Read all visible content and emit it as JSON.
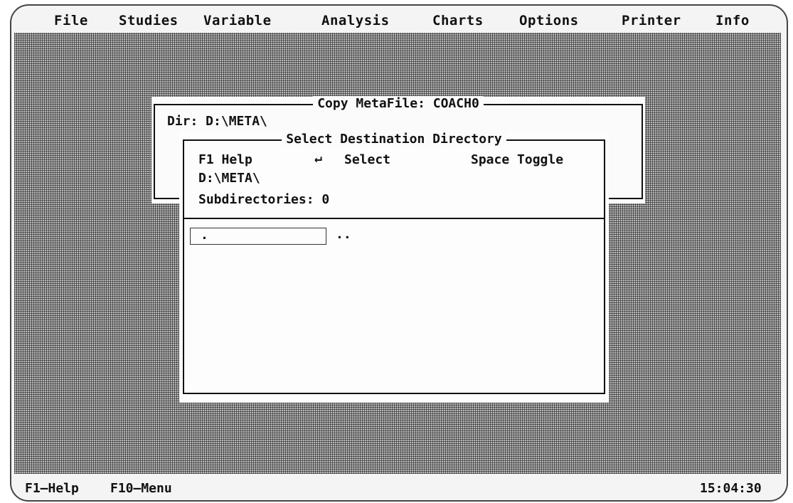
{
  "menu": {
    "items": [
      "File",
      "Studies",
      "Variable",
      "Analysis",
      "Charts",
      "Options",
      "Printer",
      "Info"
    ]
  },
  "copy_dialog": {
    "title": "Copy MetaFile: COACH0",
    "dir_label": "Dir: D:\\META\\"
  },
  "select_dialog": {
    "title": "Select Destination Directory",
    "hint_help": "F1 Help",
    "hint_select_icon": "↵",
    "hint_select": "Select",
    "hint_toggle": "Space Toggle",
    "path": "D:\\META\\",
    "subdirectories": "Subdirectories: 0",
    "entries": [
      ".",
      ".."
    ]
  },
  "status": {
    "help": "F1—Help",
    "menu": "F10—Menu",
    "clock": "15:04:30"
  },
  "colors": {
    "background": "#ffffff",
    "text": "#111111",
    "desktop_dither": "#b8b8b8"
  }
}
